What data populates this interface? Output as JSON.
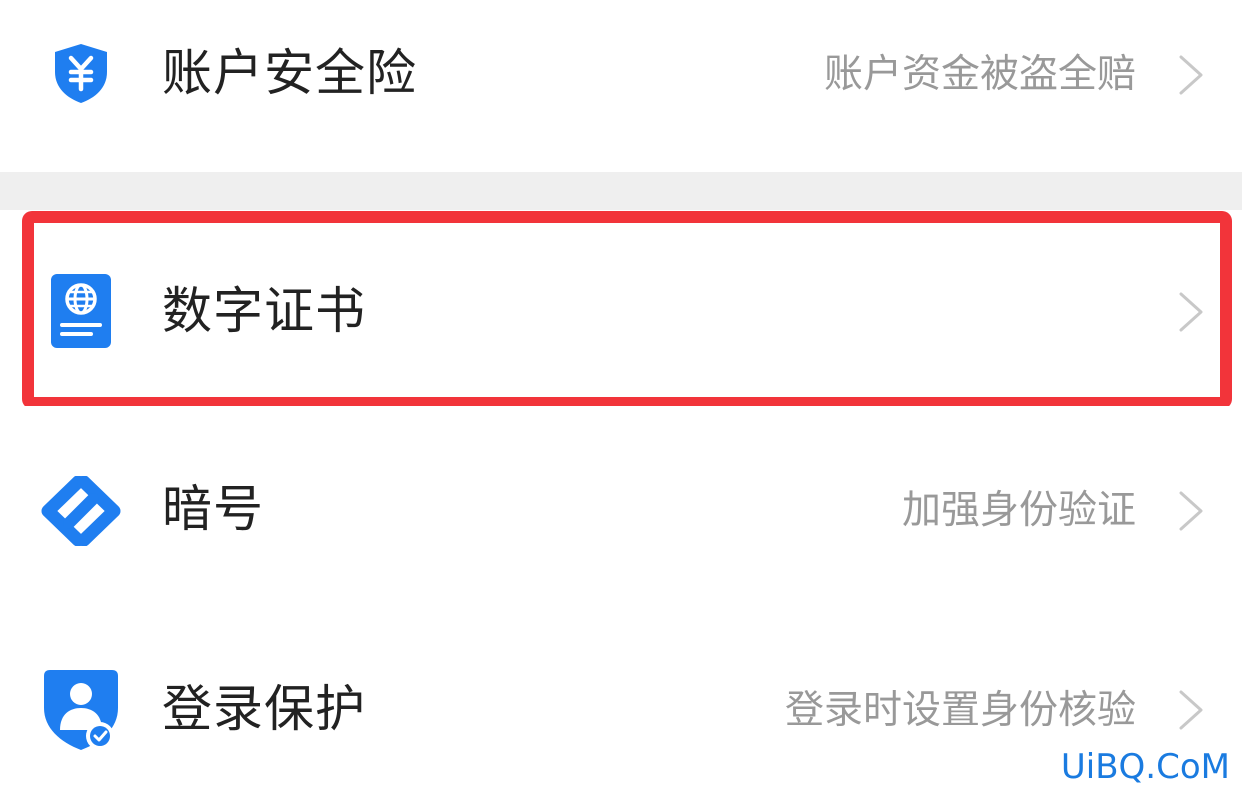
{
  "colors": {
    "accent": "#1f7ef0",
    "highlight": "#f2343a",
    "divider": "#efefef",
    "title": "#222222",
    "subtitle": "#999999"
  },
  "rows": [
    {
      "title": "账户安全险",
      "subtitle": "账户资金被盗全赔",
      "icon": "yuan-shield-icon"
    },
    {
      "title": "数字证书",
      "subtitle": "",
      "icon": "passport-globe-icon"
    },
    {
      "title": "暗号",
      "subtitle": "加强身份验证",
      "icon": "link-diamond-icon"
    },
    {
      "title": "登录保护",
      "subtitle": "登录时设置身份核验",
      "icon": "user-shield-check-icon"
    }
  ],
  "watermark": "UiBQ.CoM"
}
